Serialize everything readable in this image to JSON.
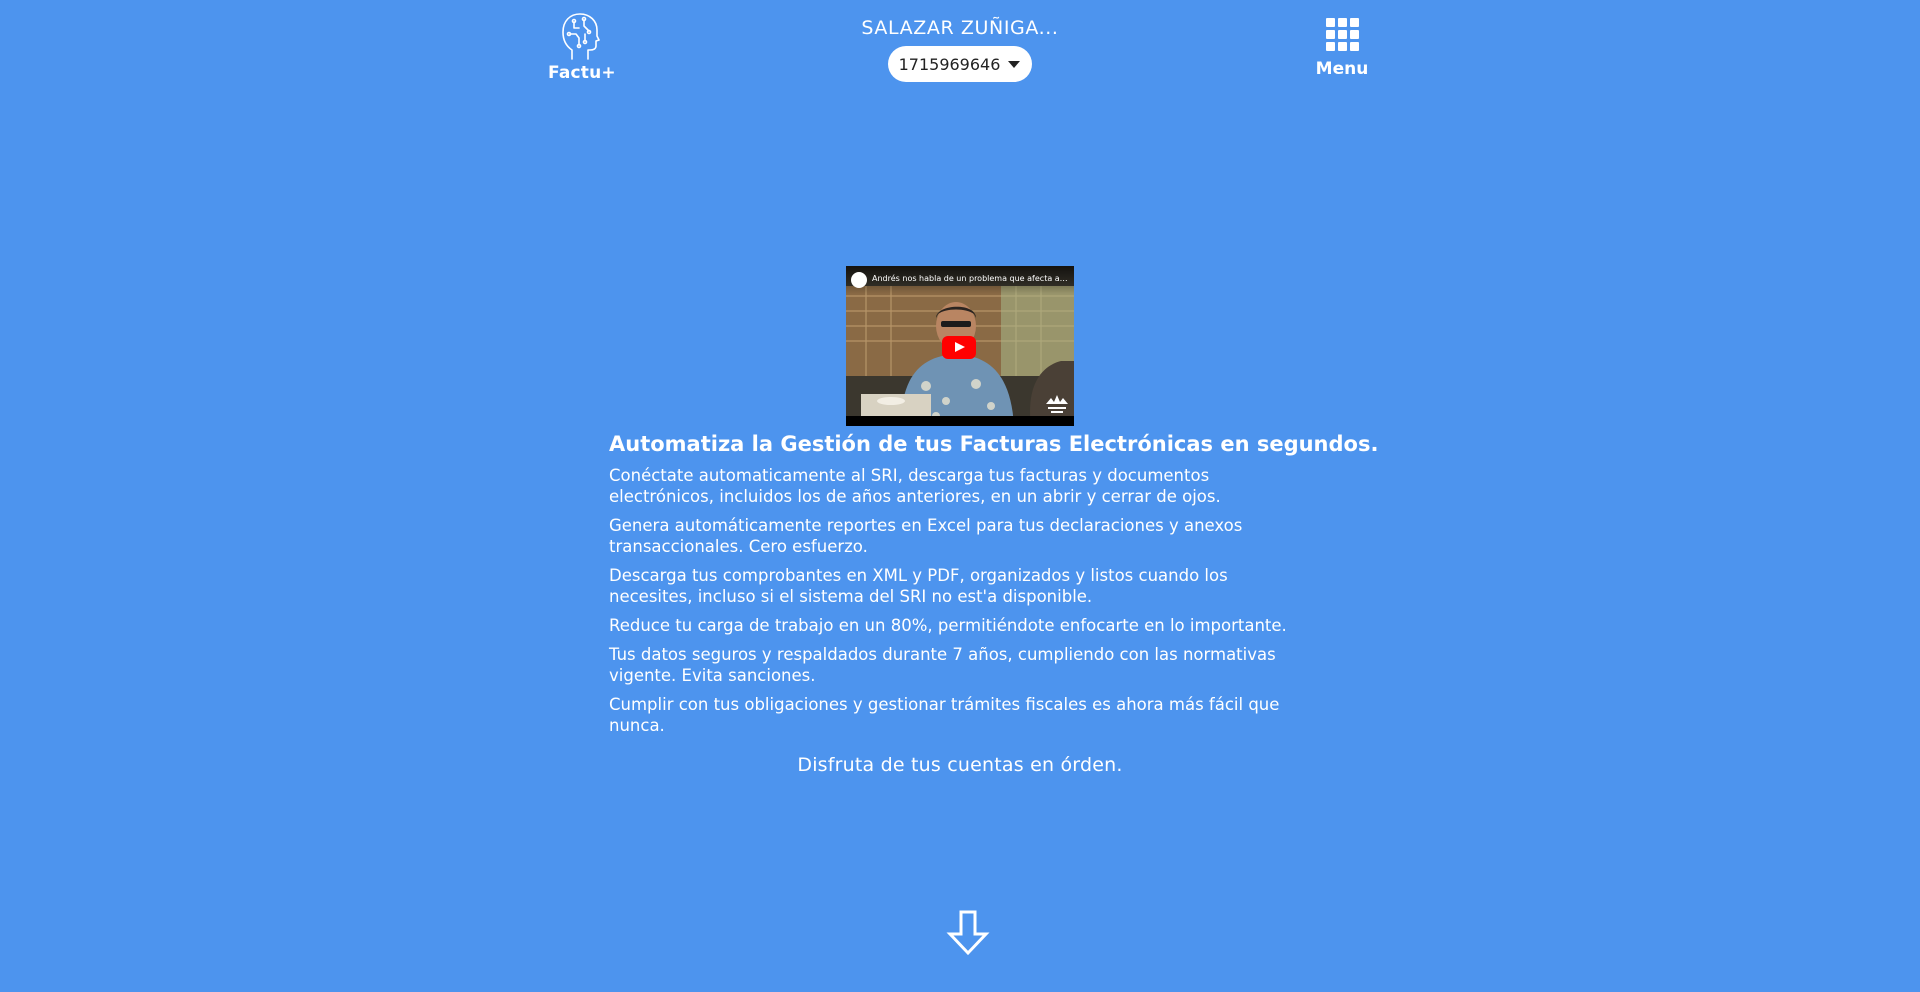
{
  "header": {
    "brand_label": "Factu+",
    "account_name": "SALAZAR ZUÑIGA...",
    "ruc_selected": "1715969646",
    "menu_label": "Menu"
  },
  "video": {
    "title": "Andrés nos habla de un problema que afecta a homb..."
  },
  "main": {
    "headline": "Automatiza la Gestión de tus Facturas Electrónicas en segundos.",
    "features": [
      "Conéctate automaticamente al SRI, descarga tus facturas y documentos electrónicos, incluidos los de años anteriores, en un abrir y cerrar de ojos.",
      "Genera automáticamente reportes en Excel para tus declaraciones y anexos transaccionales. Cero esfuerzo.",
      "Descarga tus comprobantes en XML y PDF, organizados y listos cuando los necesites, incluso si el sistema del SRI no est'a disponible.",
      "Reduce tu carga de trabajo en un 80%, permitiéndote enfocarte en lo importante.",
      "Tus datos seguros y respaldados durante 7 años, cumpliendo con las normativas vigente. Evita sanciones.",
      "Cumplir con tus obligaciones y gestionar trámites fiscales es ahora más fácil que nunca."
    ],
    "tagline": "Disfruta de tus cuentas en órden."
  },
  "colors": {
    "background": "#4d94ee",
    "text": "#ffffff",
    "play_button": "#ff0000"
  },
  "icons": {
    "brand": "head-circuit-icon",
    "menu": "grid-icon",
    "scroll": "arrow-down-icon"
  }
}
